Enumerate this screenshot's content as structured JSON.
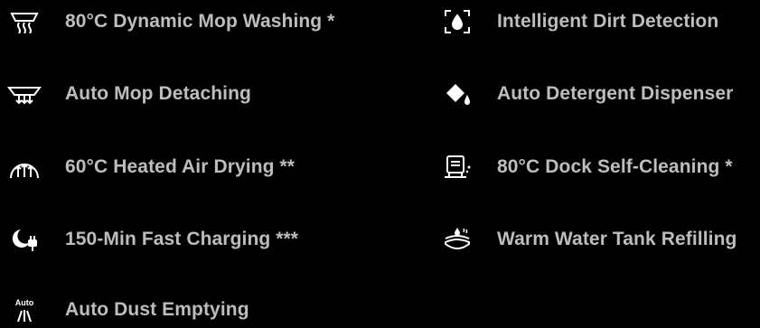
{
  "features": {
    "left": [
      {
        "label": "80°C Dynamic Mop Washing *",
        "icon": "mop-washing-icon"
      },
      {
        "label": "Auto Mop Detaching",
        "icon": "mop-detach-icon"
      },
      {
        "label": "60°C Heated Air Drying **",
        "icon": "air-drying-icon"
      },
      {
        "label": "150-Min Fast Charging ***",
        "icon": "fast-charging-icon"
      },
      {
        "label": "Auto Dust Emptying",
        "icon": "dust-emptying-icon",
        "icon_text": "Auto"
      }
    ],
    "right": [
      {
        "label": "Intelligent Dirt Detection",
        "icon": "dirt-detection-icon"
      },
      {
        "label": "Auto Detergent Dispenser",
        "icon": "detergent-icon"
      },
      {
        "label": "80°C Dock Self-Cleaning *",
        "icon": "dock-cleaning-icon"
      },
      {
        "label": "Warm Water Tank Refilling",
        "icon": "water-refill-icon"
      }
    ]
  },
  "colors": {
    "background": "#000000",
    "text": "#bdbdbd",
    "icon": "#ffffff"
  }
}
